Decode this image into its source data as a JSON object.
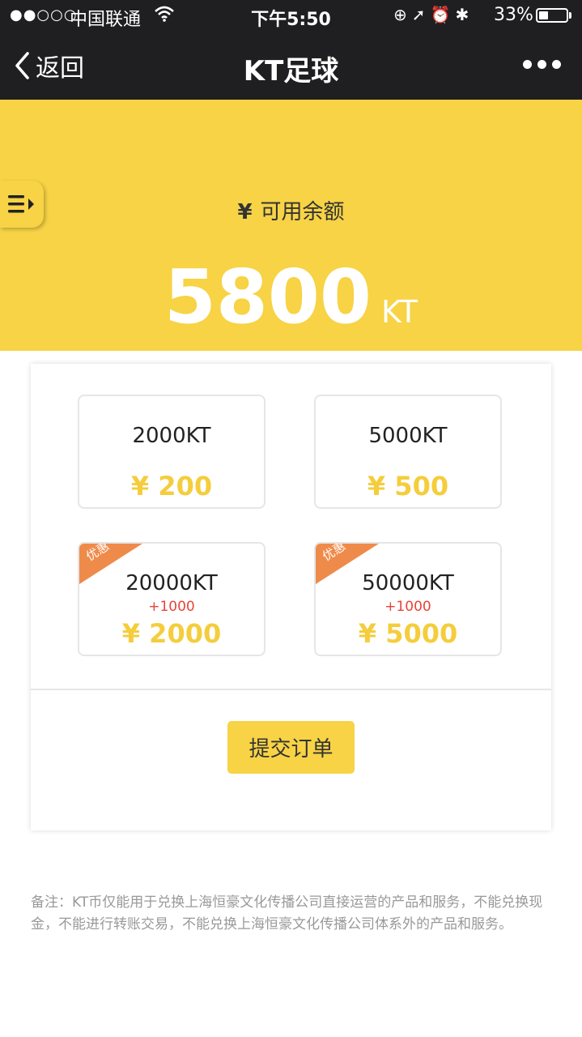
{
  "status_bar": {
    "signal": "●●○○○",
    "carrier": "中国联通",
    "time": "下午5:50",
    "battery_percent": "33%",
    "battery_level": 0.33,
    "icons": [
      "wifi-icon",
      "orientation-lock-icon",
      "location-arrow-icon",
      "alarm-icon",
      "bluetooth-icon",
      "battery-icon"
    ]
  },
  "nav": {
    "back_label": "返回",
    "title": "KT足球",
    "more_icon": "ellipsis-icon"
  },
  "hero": {
    "currency_symbol": "¥",
    "balance_label": "可用余额",
    "balance_value": "5800",
    "balance_unit": "KT",
    "background_color": "#f7d345"
  },
  "options": [
    {
      "amount": "2000KT",
      "price": "¥ 200",
      "bonus": "",
      "badge": ""
    },
    {
      "amount": "5000KT",
      "price": "¥ 500",
      "bonus": "",
      "badge": ""
    },
    {
      "amount": "20000KT",
      "price": "¥ 2000",
      "bonus": "+1000",
      "badge": "优惠"
    },
    {
      "amount": "50000KT",
      "price": "¥ 5000",
      "bonus": "+1000",
      "badge": "优惠"
    }
  ],
  "submit": {
    "label": "提交订单"
  },
  "note": "备注：KT币仅能用于兑换上海恒豪文化传播公司直接运营的产品和服务，不能兑换现金，不能进行转账交易，不能兑换上海恒豪文化传播公司体系外的产品和服务。",
  "colors": {
    "accent_yellow": "#f7d345",
    "price_yellow": "#f5cd3c",
    "badge_orange": "#ef8b4a",
    "bonus_red": "#e8443a",
    "nav_dark": "#1f1f21"
  }
}
